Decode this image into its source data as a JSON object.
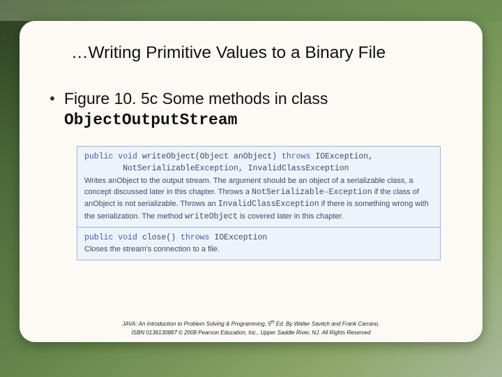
{
  "title": "…Writing Primitive Values to a Binary File",
  "bullet": "Figure 10. 5c  Some methods in class",
  "className": "ObjectOutputStream",
  "api": [
    {
      "sig_html": "<span class='kw'>public void</span> writeObject(Object anObject) <span class='kw'>throws</span> IOException,<br>&nbsp;&nbsp;&nbsp;&nbsp;&nbsp;&nbsp;&nbsp;&nbsp;NotSerializableException, InvalidClassException",
      "desc_html": "Writes anObject to the output stream. The argument should be an object of a serializable class, a concept discussed later in this chapter. Throws a <span class='mono'>NotSerializable-</span><span class='mono'>Exception</span> if the class of anObject is not serializable. Throws an <span class='mono'>InvalidClassException</span> if there is something wrong with the serialization. The method <span class='mono'>writeObject</span> is covered later in this chapter."
    },
    {
      "sig_html": "<span class='kw'>public void</span> close() <span class='kw'>throws</span> IOException",
      "desc_html": "Closes the stream's connection to a file."
    }
  ],
  "footer1_pre": "JAVA: An Introduction to Problem Solving & Programming, 5",
  "footer1_sup": "th",
  "footer1_post": " Ed. By Walter Savitch and Frank Carrano.",
  "footer2": "ISBN 0136130887 © 2008 Pearson Education, Inc., Upper Saddle River, NJ. All Rights Reserved"
}
